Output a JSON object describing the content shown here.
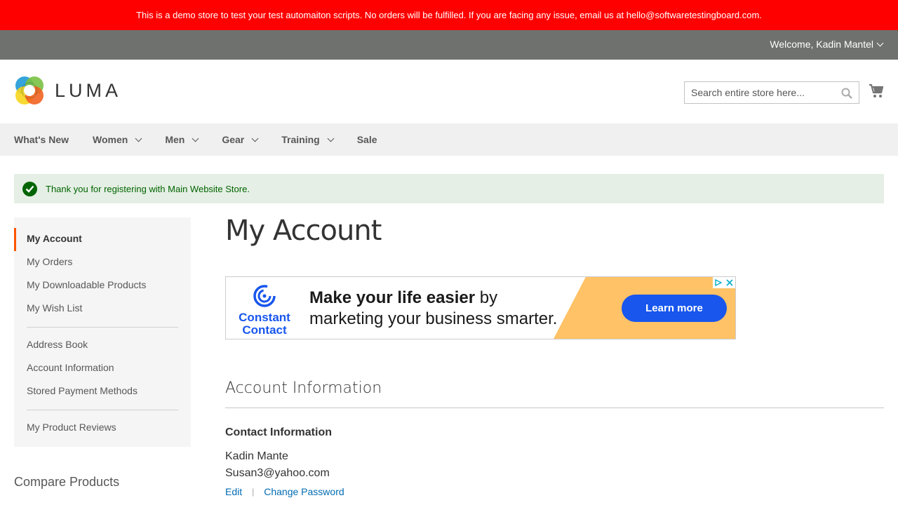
{
  "banner": {
    "text": "This is a demo store to test your test automaiton scripts. No orders will be fulfilled. If you are facing any issue, email us at hello@softwaretestingboard.com."
  },
  "header": {
    "welcome": "Welcome, Kadin Mantel",
    "logo_text": "LUMA",
    "search_placeholder": "Search entire store here..."
  },
  "nav": {
    "items": [
      {
        "label": "What's New",
        "has_dropdown": false
      },
      {
        "label": "Women",
        "has_dropdown": true
      },
      {
        "label": "Men",
        "has_dropdown": true
      },
      {
        "label": "Gear",
        "has_dropdown": true
      },
      {
        "label": "Training",
        "has_dropdown": true
      },
      {
        "label": "Sale",
        "has_dropdown": false
      }
    ]
  },
  "message": {
    "text": "Thank you for registering with Main Website Store."
  },
  "sidebar": {
    "group1": [
      "My Account",
      "My Orders",
      "My Downloadable Products",
      "My Wish List"
    ],
    "group2": [
      "Address Book",
      "Account Information",
      "Stored Payment Methods"
    ],
    "group3": [
      "My Product Reviews"
    ],
    "compare_title": "Compare Products"
  },
  "main": {
    "page_title": "My Account",
    "section_title": "Account Information",
    "contact_title": "Contact Information",
    "contact_name": "Kadin Mante",
    "contact_email": "Susan3@yahoo.com",
    "edit_label": "Edit",
    "change_password_label": "Change Password"
  },
  "ad": {
    "brand_line1": "Constant",
    "brand_line2": "Contact",
    "headline_bold": "Make your life easier",
    "headline_rest": " by",
    "headline_line2": "marketing your business smarter.",
    "cta": "Learn more"
  },
  "colors": {
    "banner_bg": "#ff0000",
    "panel_bg": "#6e716e",
    "nav_bg": "#f0f0f0",
    "success_bg": "#e5efe5",
    "success_text": "#006400",
    "active_marker": "#ff5501",
    "link": "#006bb4",
    "ad_blue": "#1856ed",
    "ad_yellow": "#ffc266"
  }
}
